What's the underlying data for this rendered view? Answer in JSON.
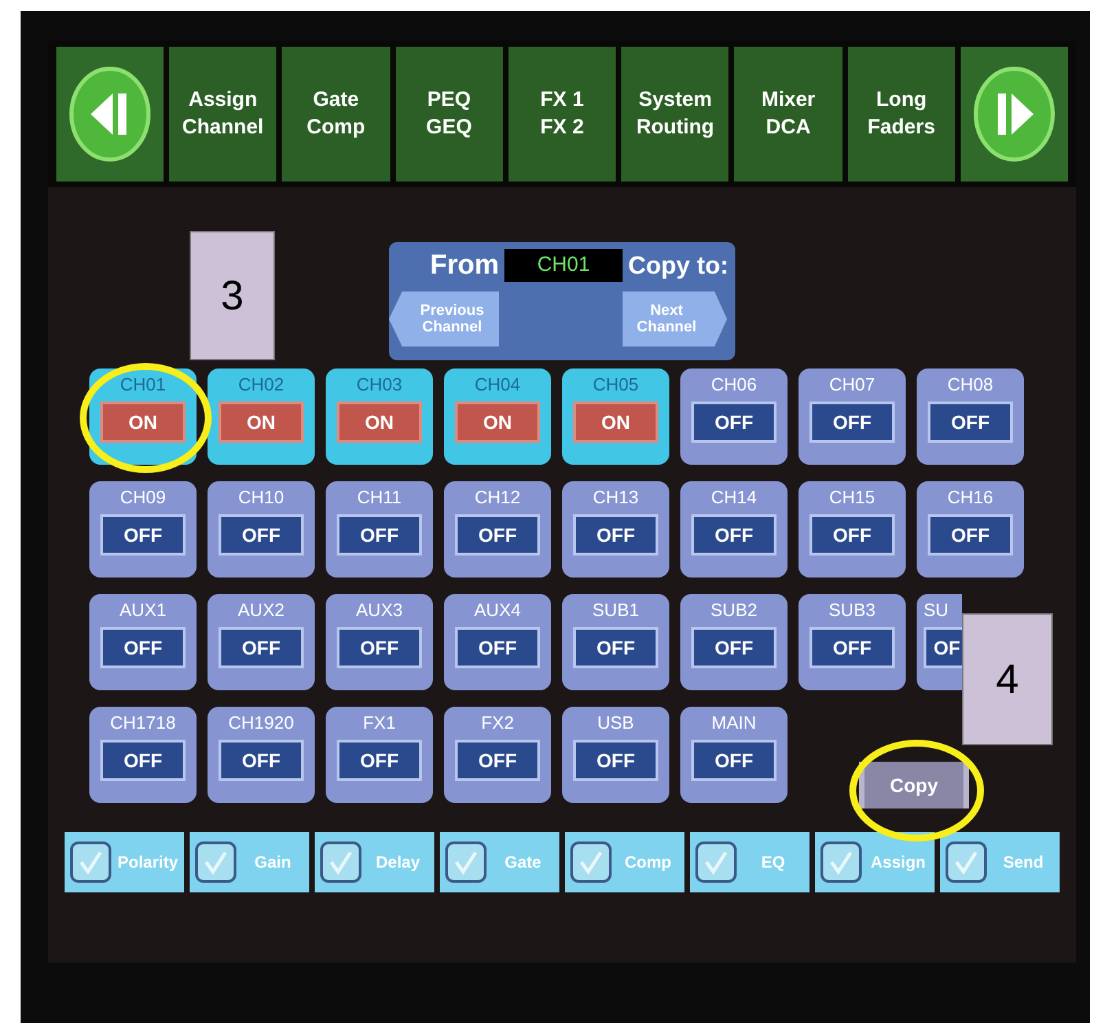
{
  "nav": {
    "tabs": [
      {
        "lines": [
          "Assign",
          "Channel"
        ]
      },
      {
        "lines": [
          "Gate",
          "Comp"
        ]
      },
      {
        "lines": [
          "PEQ",
          "GEQ"
        ]
      },
      {
        "lines": [
          "FX 1",
          "FX 2"
        ]
      },
      {
        "lines": [
          "System",
          "Routing"
        ]
      },
      {
        "lines": [
          "Mixer",
          "DCA"
        ]
      },
      {
        "lines": [
          "Long",
          "Faders"
        ]
      }
    ]
  },
  "copy_panel": {
    "from_label": "From",
    "source": "CH01",
    "copy_to_label": "Copy to:",
    "previous_button": "Previous Channel",
    "next_button": "Next Channel"
  },
  "channels": [
    {
      "name": "CH01",
      "on": true,
      "label": "ON",
      "cut": false
    },
    {
      "name": "CH02",
      "on": true,
      "label": "ON",
      "cut": false
    },
    {
      "name": "CH03",
      "on": true,
      "label": "ON",
      "cut": false
    },
    {
      "name": "CH04",
      "on": true,
      "label": "ON",
      "cut": false
    },
    {
      "name": "CH05",
      "on": true,
      "label": "ON",
      "cut": false
    },
    {
      "name": "CH06",
      "on": false,
      "label": "OFF",
      "cut": false
    },
    {
      "name": "CH07",
      "on": false,
      "label": "OFF",
      "cut": false
    },
    {
      "name": "CH08",
      "on": false,
      "label": "OFF",
      "cut": false
    },
    {
      "name": "CH09",
      "on": false,
      "label": "OFF",
      "cut": false
    },
    {
      "name": "CH10",
      "on": false,
      "label": "OFF",
      "cut": false
    },
    {
      "name": "CH11",
      "on": false,
      "label": "OFF",
      "cut": false
    },
    {
      "name": "CH12",
      "on": false,
      "label": "OFF",
      "cut": false
    },
    {
      "name": "CH13",
      "on": false,
      "label": "OFF",
      "cut": false
    },
    {
      "name": "CH14",
      "on": false,
      "label": "OFF",
      "cut": false
    },
    {
      "name": "CH15",
      "on": false,
      "label": "OFF",
      "cut": false
    },
    {
      "name": "CH16",
      "on": false,
      "label": "OFF",
      "cut": false
    },
    {
      "name": "AUX1",
      "on": false,
      "label": "OFF",
      "cut": false
    },
    {
      "name": "AUX2",
      "on": false,
      "label": "OFF",
      "cut": false
    },
    {
      "name": "AUX3",
      "on": false,
      "label": "OFF",
      "cut": false
    },
    {
      "name": "AUX4",
      "on": false,
      "label": "OFF",
      "cut": false
    },
    {
      "name": "SUB1",
      "on": false,
      "label": "OFF",
      "cut": false
    },
    {
      "name": "SUB2",
      "on": false,
      "label": "OFF",
      "cut": false
    },
    {
      "name": "SUB3",
      "on": false,
      "label": "OFF",
      "cut": false
    },
    {
      "name": "SU",
      "on": false,
      "label": "OF",
      "cut": true
    },
    {
      "name": "CH1718",
      "on": false,
      "label": "OFF",
      "cut": false
    },
    {
      "name": "CH1920",
      "on": false,
      "label": "OFF",
      "cut": false
    },
    {
      "name": "FX1",
      "on": false,
      "label": "OFF",
      "cut": false
    },
    {
      "name": "FX2",
      "on": false,
      "label": "OFF",
      "cut": false
    },
    {
      "name": "USB",
      "on": false,
      "label": "OFF",
      "cut": false
    },
    {
      "name": "MAIN",
      "on": false,
      "label": "OFF",
      "cut": false
    }
  ],
  "copy_button": "Copy",
  "options": [
    {
      "label": "Polarity",
      "checked": true
    },
    {
      "label": "Gain",
      "checked": true
    },
    {
      "label": "Delay",
      "checked": true
    },
    {
      "label": "Gate",
      "checked": true
    },
    {
      "label": "Comp",
      "checked": true
    },
    {
      "label": "EQ",
      "checked": true
    },
    {
      "label": "Assign",
      "checked": true
    },
    {
      "label": "Send",
      "checked": true
    }
  ],
  "callouts": [
    {
      "number": "3"
    },
    {
      "number": "4"
    }
  ]
}
